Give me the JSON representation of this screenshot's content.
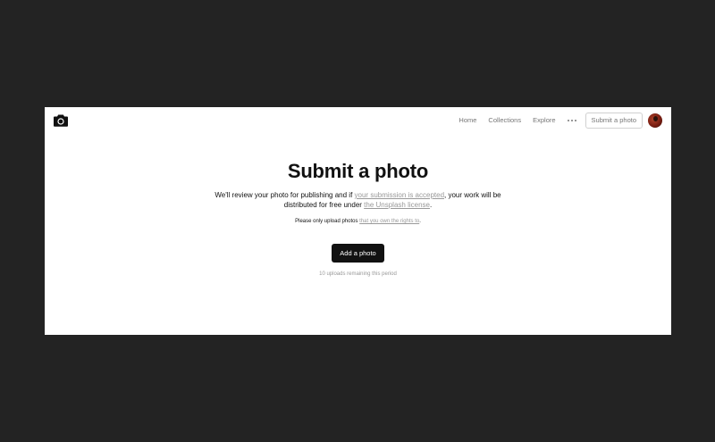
{
  "navbar": {
    "logo_icon": "camera-icon",
    "links": {
      "home": "Home",
      "collections": "Collections",
      "explore": "Explore"
    },
    "more_icon": "ellipsis-icon",
    "submit_label": "Submit a photo",
    "avatar_icon": "user-avatar"
  },
  "main": {
    "title": "Submit a photo",
    "description": {
      "part1": "We'll review your photo for publishing and if ",
      "link1": "your submission is accepted",
      "part2": ", your work will be distributed for free under ",
      "link2": "the Unsplash license",
      "part3": "."
    },
    "note": {
      "text": "Please only upload photos ",
      "link": "that you own the rights to",
      "end": "."
    },
    "add_button": "Add a photo",
    "remaining": "10 uploads remaining this period"
  },
  "colors": {
    "backdrop": "#232323",
    "page": "#ffffff",
    "primary_button": "#111111",
    "muted_text": "#999999"
  }
}
